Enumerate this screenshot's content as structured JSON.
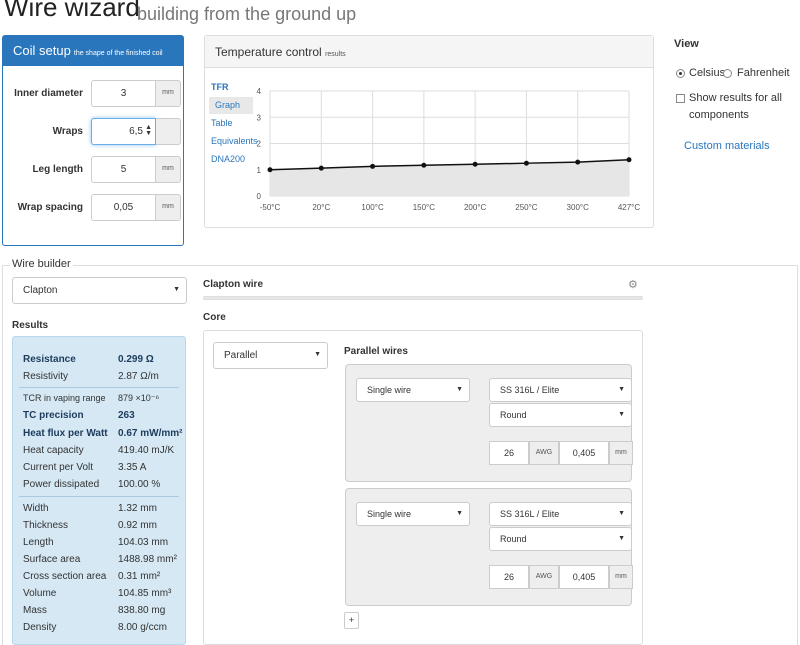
{
  "header": {
    "title": "Wire wizard",
    "subtitle": "building from the ground up"
  },
  "coil_setup": {
    "title": "Coil setup",
    "subtitle": "the shape of the finished coil",
    "fields": [
      {
        "label": "Inner diameter",
        "value": "3",
        "unit": "mm"
      },
      {
        "label": "Wraps",
        "value": "6,5"
      },
      {
        "label": "Leg length",
        "value": "5",
        "unit": "mm"
      },
      {
        "label": "Wrap spacing",
        "value": "0,05",
        "unit": "mm"
      }
    ]
  },
  "temperature_control": {
    "title": "Temperature control",
    "subtitle": "results",
    "nav": [
      {
        "label": "TFR",
        "active": false
      },
      {
        "label": "Graph",
        "active": true
      },
      {
        "label": "Table",
        "active": false
      },
      {
        "label": "Equivalents",
        "active": false
      },
      {
        "label": "DNA200",
        "active": false
      }
    ]
  },
  "chart_data": {
    "type": "line",
    "x": [
      "-50°C",
      "20°C",
      "100°C",
      "150°C",
      "200°C",
      "250°C",
      "300°C",
      "427°C"
    ],
    "series": [
      {
        "values": [
          1.0,
          1.06,
          1.13,
          1.17,
          1.21,
          1.25,
          1.29,
          1.38
        ]
      }
    ],
    "ylim": [
      0,
      4
    ],
    "yticks": [
      "0",
      "1",
      "2",
      "3",
      "4"
    ],
    "grid": true,
    "colors": {
      "line": "#111111",
      "fill": "#e6e6e6",
      "grid": "#dddddd"
    }
  },
  "view": {
    "title": "View",
    "radio_celsius": "Celsius",
    "radio_fahrenheit": "Fahrenheit",
    "checkbox_label_1": "Show results for all",
    "checkbox_label_2": "components",
    "custom_link": "Custom materials"
  },
  "wire_builder": {
    "legend": "Wire builder",
    "type_select": "Clapton",
    "results_label": "Results",
    "clapton_label": "Clapton wire",
    "core_label": "Core",
    "core_select": "Parallel",
    "parallel_label": "Parallel wires",
    "add_button": "+",
    "wires": [
      {
        "type": "Single wire",
        "material": "SS 316L / Elite",
        "shape": "Round",
        "gauge": "26",
        "gauge_unit": "AWG",
        "diameter": "0,405",
        "unit": "mm"
      },
      {
        "type": "Single wire",
        "material": "SS 316L / Elite",
        "shape": "Round",
        "gauge": "26",
        "gauge_unit": "AWG",
        "diameter": "0,405",
        "unit": "mm"
      }
    ]
  },
  "results": {
    "resistance": {
      "label": "Resistance",
      "value": "0.299 Ω"
    },
    "resistivity": {
      "label": "Resistivity",
      "value": "2.87 Ω/m"
    },
    "tcr": {
      "label": "TCR in vaping range",
      "value": "879 ×10⁻⁶"
    },
    "tc_precision": {
      "label": "TC precision",
      "value": "263"
    },
    "heat_flux": {
      "label": "Heat flux per Watt",
      "value": "0.67 mW/mm²"
    },
    "heat_capacity": {
      "label": "Heat capacity",
      "value": "419.40 mJ/K"
    },
    "current": {
      "label": "Current per Volt",
      "value": "3.35 A"
    },
    "power": {
      "label": "Power dissipated",
      "value": "100.00 %"
    },
    "width": {
      "label": "Width",
      "value": "1.32 mm"
    },
    "thickness": {
      "label": "Thickness",
      "value": "0.92 mm"
    },
    "length": {
      "label": "Length",
      "value": "104.03 mm"
    },
    "surface": {
      "label": "Surface area",
      "value": "1488.98 mm²"
    },
    "cross": {
      "label": "Cross section area",
      "value": "0.31 mm²"
    },
    "volume": {
      "label": "Volume",
      "value": "104.85 mm³"
    },
    "mass": {
      "label": "Mass",
      "value": "838.80 mg"
    },
    "density": {
      "label": "Density",
      "value": "8.00 g/ccm"
    }
  }
}
